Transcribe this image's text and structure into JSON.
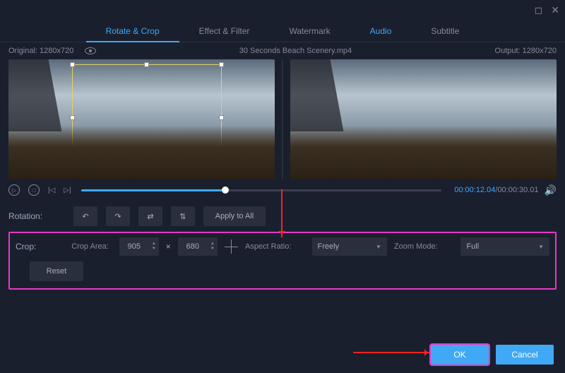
{
  "titlebar": {
    "maximize": "◻",
    "close": "✕"
  },
  "tabs": {
    "rotate_crop": "Rotate & Crop",
    "effect_filter": "Effect & Filter",
    "watermark": "Watermark",
    "audio": "Audio",
    "subtitle": "Subtitle"
  },
  "infobar": {
    "original": "Original: 1280x720",
    "filename": "30 Seconds Beach Scenery.mp4",
    "output": "Output: 1280x720"
  },
  "playback": {
    "current": "00:00:12.04",
    "total": "00:00:30.01"
  },
  "rotation": {
    "label": "Rotation:",
    "apply_all": "Apply to All"
  },
  "crop": {
    "label": "Crop:",
    "area_label": "Crop Area:",
    "w": "905",
    "x": "×",
    "h": "680",
    "aspect_label": "Aspect Ratio:",
    "aspect_value": "Freely",
    "zoom_label": "Zoom Mode:",
    "zoom_value": "Full",
    "reset": "Reset"
  },
  "footer": {
    "ok": "OK",
    "cancel": "Cancel"
  }
}
